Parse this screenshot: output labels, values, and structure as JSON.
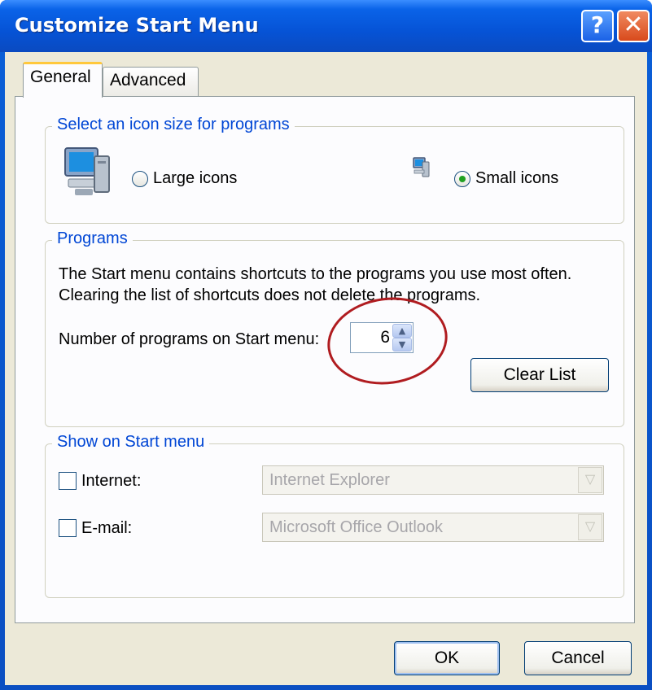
{
  "window": {
    "title": "Customize Start Menu",
    "help_glyph": "?",
    "close_glyph": "✕"
  },
  "tabs": [
    {
      "label": "General",
      "active": true
    },
    {
      "label": "Advanced",
      "active": false
    }
  ],
  "icon_size": {
    "legend": "Select an icon size for programs",
    "large_label": "Large icons",
    "small_label": "Small icons",
    "selected": "small"
  },
  "programs": {
    "legend": "Programs",
    "description_line1": "The Start menu contains shortcuts to the programs you use most often.",
    "description_line2": "Clearing the list of shortcuts does not delete the programs.",
    "count_label": "Number of programs on Start menu:",
    "count_value": "6",
    "clear_button": "Clear List"
  },
  "show_on_start": {
    "legend": "Show on Start menu",
    "internet_label": "Internet:",
    "internet_checked": false,
    "internet_value": "Internet Explorer",
    "email_label": "E-mail:",
    "email_checked": false,
    "email_value": "Microsoft Office Outlook"
  },
  "footer": {
    "ok": "OK",
    "cancel": "Cancel"
  },
  "colors": {
    "titlebar": "#0653d6",
    "legend_text": "#0046d5",
    "annotation_circle": "#b01c20"
  },
  "icons": [
    "computer-large-icon",
    "computer-small-icon",
    "spin-up-icon",
    "spin-down-icon",
    "dropdown-arrow-icon"
  ]
}
